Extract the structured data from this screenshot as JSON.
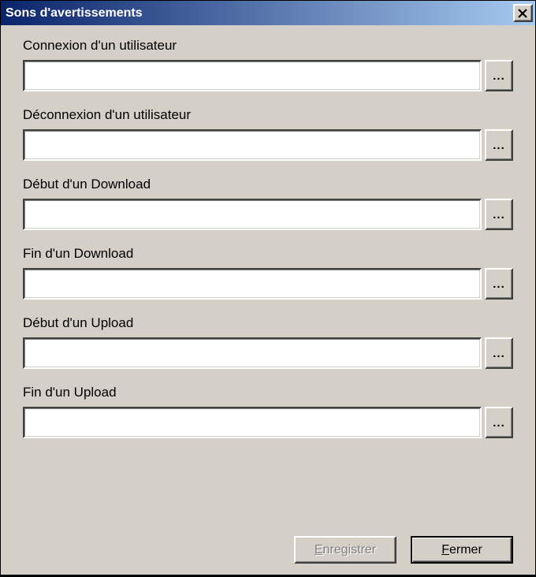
{
  "title": "Sons d'avertissements",
  "fields": [
    {
      "label": "Connexion d'un utilisateur",
      "value": ""
    },
    {
      "label": "Déconnexion d'un utilisateur",
      "value": ""
    },
    {
      "label": "Début d'un Download",
      "value": ""
    },
    {
      "label": "Fin d'un Download",
      "value": ""
    },
    {
      "label": "Début d'un Upload",
      "value": ""
    },
    {
      "label": "Fin d'un Upload",
      "value": ""
    }
  ],
  "browse_label": "...",
  "buttons": {
    "save_prefix": "E",
    "save_rest": "nregistrer",
    "close_prefix": "F",
    "close_rest": "ermer"
  }
}
